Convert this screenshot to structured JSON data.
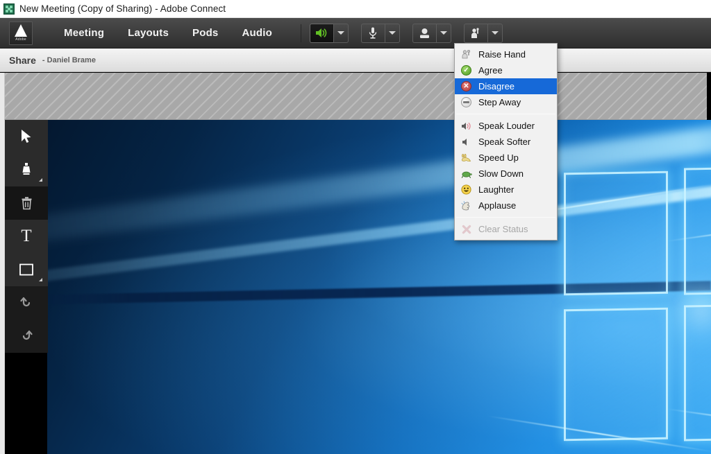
{
  "window": {
    "title": "New Meeting (Copy of Sharing) - Adobe Connect",
    "app_icon": "connect-app-icon"
  },
  "toolbar": {
    "brand": {
      "logo_letter": "A",
      "logo_word": "Adobe"
    },
    "menus": [
      {
        "label": "Meeting",
        "name": "menu-meeting"
      },
      {
        "label": "Layouts",
        "name": "menu-layouts"
      },
      {
        "label": "Pods",
        "name": "menu-pods"
      },
      {
        "label": "Audio",
        "name": "menu-audio"
      }
    ],
    "device_buttons": [
      {
        "name": "speaker-button",
        "icon": "speaker-icon",
        "state": "active"
      },
      {
        "name": "microphone-button",
        "icon": "microphone-icon",
        "state": "off"
      },
      {
        "name": "webcam-button",
        "icon": "webcam-icon",
        "state": "off"
      },
      {
        "name": "status-button",
        "icon": "raise-hand-icon",
        "state": "menu-open"
      }
    ]
  },
  "pod": {
    "title": "Share",
    "presenter": "- Daniel Brame"
  },
  "tools": [
    {
      "name": "pointer-tool",
      "icon": "pointer-icon",
      "has_submenu": false
    },
    {
      "name": "marker-tool",
      "icon": "marker-icon",
      "has_submenu": true
    },
    {
      "name": "delete-tool",
      "icon": "trash-icon",
      "has_submenu": false
    },
    {
      "name": "text-tool",
      "icon": "text-icon",
      "glyph": "T",
      "has_submenu": false
    },
    {
      "name": "shape-tool",
      "icon": "rectangle-icon",
      "has_submenu": true
    },
    {
      "name": "undo-tool",
      "icon": "undo-icon",
      "has_submenu": false
    },
    {
      "name": "redo-tool",
      "icon": "redo-icon",
      "has_submenu": false
    }
  ],
  "status_menu": {
    "open": true,
    "highlight_color": "#1669d8",
    "groups": [
      {
        "items": [
          {
            "label": "Raise Hand",
            "icon": "raise-hand-icon",
            "selected": false,
            "disabled": false
          },
          {
            "label": "Agree",
            "icon": "agree-check-icon",
            "selected": false,
            "disabled": false
          },
          {
            "label": "Disagree",
            "icon": "disagree-x-icon",
            "selected": true,
            "disabled": false
          },
          {
            "label": "Step Away",
            "icon": "step-away-icon",
            "selected": false,
            "disabled": false
          }
        ]
      },
      {
        "items": [
          {
            "label": "Speak Louder",
            "icon": "speak-louder-icon",
            "selected": false,
            "disabled": false
          },
          {
            "label": "Speak Softer",
            "icon": "speak-softer-icon",
            "selected": false,
            "disabled": false
          },
          {
            "label": "Speed Up",
            "icon": "rabbit-icon",
            "selected": false,
            "disabled": false
          },
          {
            "label": "Slow Down",
            "icon": "turtle-icon",
            "selected": false,
            "disabled": false
          },
          {
            "label": "Laughter",
            "icon": "smiley-icon",
            "selected": false,
            "disabled": false
          },
          {
            "label": "Applause",
            "icon": "applause-icon",
            "selected": false,
            "disabled": false
          }
        ]
      },
      {
        "items": [
          {
            "label": "Clear Status",
            "icon": "clear-status-icon",
            "selected": false,
            "disabled": true
          }
        ]
      }
    ]
  },
  "desktop": {
    "wallpaper": "windows-10-hero-wallpaper",
    "accent_color": "#1b8ae0"
  }
}
